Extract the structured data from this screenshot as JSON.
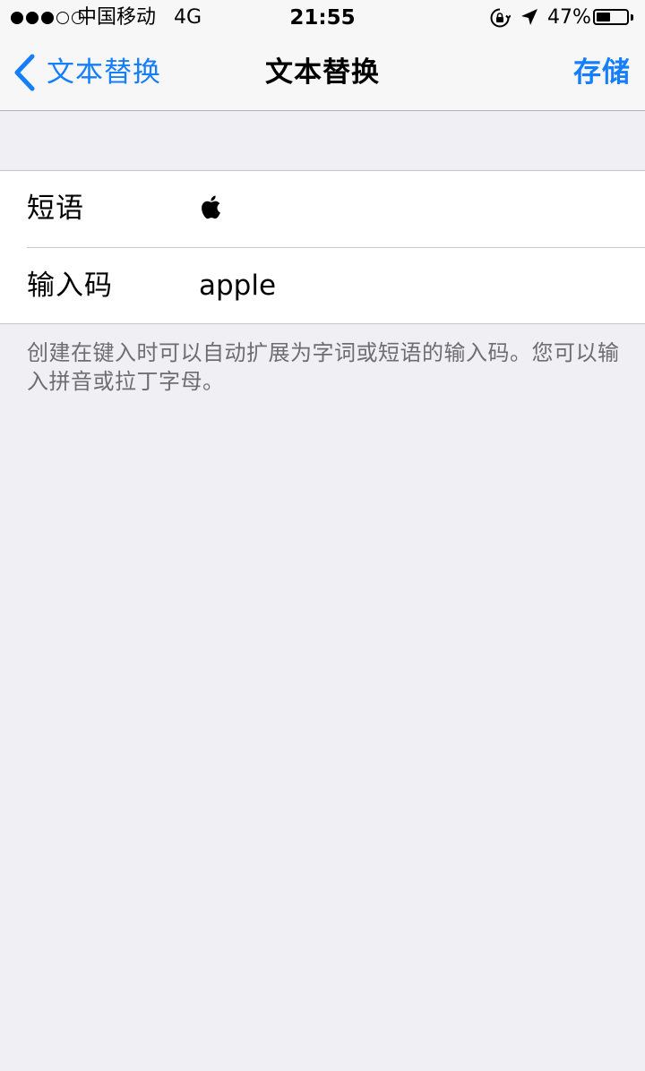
{
  "status_bar": {
    "carrier": "中国移动",
    "network": "4G",
    "time": "21:55",
    "battery_percent": "47%",
    "battery_level": 0.47,
    "signal_bars_filled": 3,
    "signal_bars_total": 5
  },
  "nav": {
    "back_label": "文本替换",
    "title": "文本替换",
    "save_label": "存储"
  },
  "form": {
    "phrase_label": "短语",
    "phrase_value_icon": "apple-logo-icon",
    "shortcut_label": "输入码",
    "shortcut_value": "apple"
  },
  "footer": {
    "note": "创建在键入时可以自动扩展为字词或短语的输入码。您可以输入拼音或拉丁字母。"
  },
  "colors": {
    "accent": "#157efb",
    "background": "#efeff4",
    "nav_background": "#f7f7f8",
    "footer_text": "#6d6d72"
  }
}
